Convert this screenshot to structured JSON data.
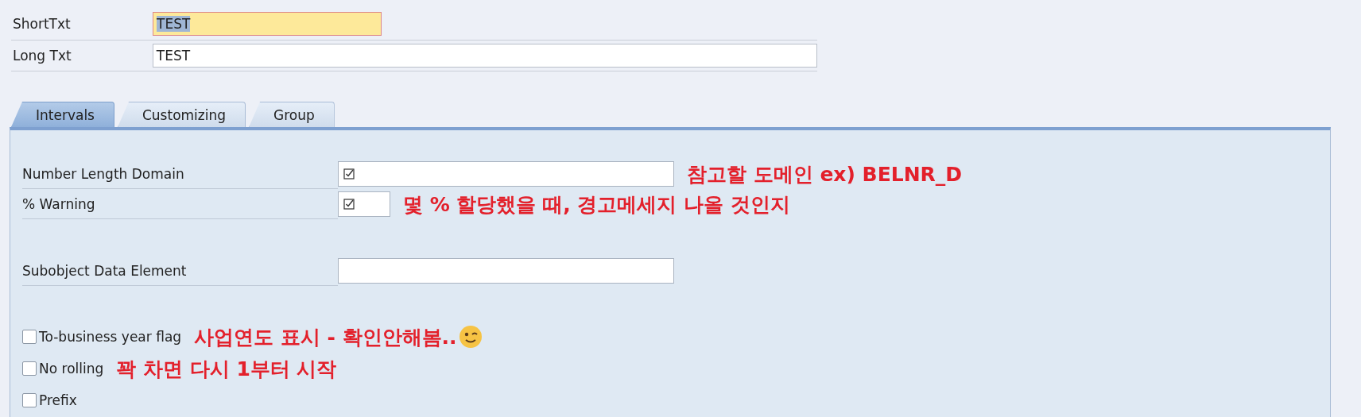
{
  "header_fields": [
    {
      "label": "ShortTxt",
      "value": "TEST",
      "focused": true
    },
    {
      "label": "Long Txt",
      "value": "TEST",
      "focused": false
    }
  ],
  "tabs": [
    {
      "label": "Intervals",
      "selected": true
    },
    {
      "label": "Customizing",
      "selected": false
    },
    {
      "label": "Group",
      "selected": false
    }
  ],
  "field_groups": [
    [
      {
        "label": "Number Length Domain",
        "kind": "wide",
        "annotation": "참고할 도메인 ex) BELNR_D"
      },
      {
        "label": "% Warning",
        "kind": "narrow",
        "annotation": "몇 % 할당했을 때, 경고메세지 나올 것인지"
      }
    ],
    [
      {
        "label": "Subobject Data Element",
        "kind": "blank"
      }
    ]
  ],
  "checkboxes": [
    {
      "label": "To-business year flag",
      "checked": false,
      "annotation": "사업연도 표시 - 확인안해봄..",
      "emoji": true
    },
    {
      "label": "No rolling",
      "checked": false,
      "annotation": "꽉 차면 다시 1부터 시작",
      "emoji": false
    },
    {
      "label": "Prefix",
      "checked": false,
      "emoji": false
    }
  ]
}
